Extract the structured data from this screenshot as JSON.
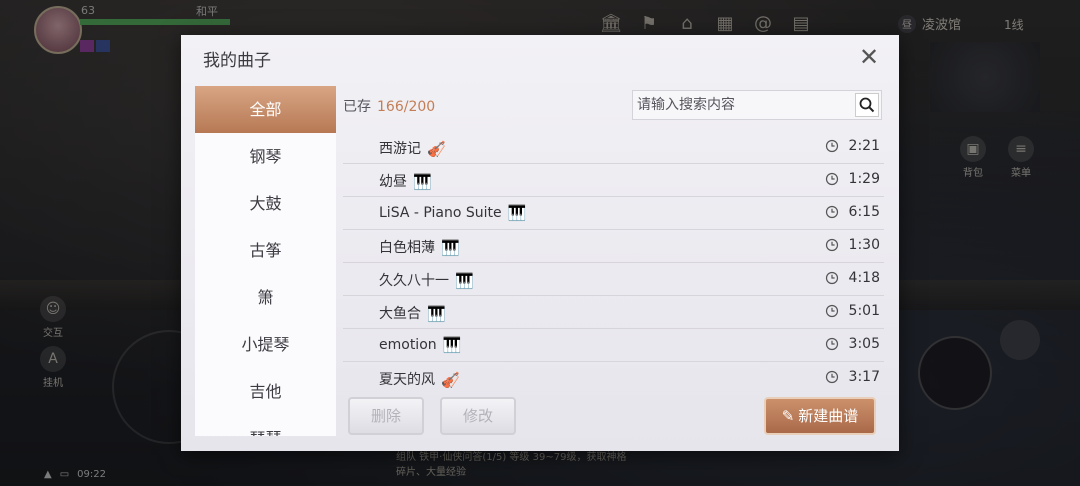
{
  "hud": {
    "level": "63",
    "mode": "和平",
    "location": "凌波馆",
    "location_badge": "昼",
    "line": "1线",
    "side_left": [
      "交互",
      "挂机"
    ],
    "side_right": [
      "背包",
      "菜单"
    ],
    "task_text": "组队  铁甲·仙侠问答(1/5)  等级 39~79级，获取神格碎片、大量经验",
    "time": "09:22"
  },
  "modal": {
    "title": "我的曲子",
    "close_icon": "close-icon",
    "categories": [
      "全部",
      "钢琴",
      "大鼓",
      "古筝",
      "箫",
      "小提琴",
      "吉他",
      "琵琶"
    ],
    "active_category": "全部",
    "stored_label": "已存",
    "stored_count": "166/200",
    "search_placeholder": "请输入搜索内容",
    "songs": [
      {
        "name": "西游记",
        "instrument": "violin-icon",
        "duration": "2:21"
      },
      {
        "name": "幼昼",
        "instrument": "piano-icon",
        "duration": "1:29"
      },
      {
        "name": "LiSA - Piano Suite",
        "instrument": "piano-icon",
        "duration": "6:15"
      },
      {
        "name": "白色相薄",
        "instrument": "piano-icon",
        "duration": "1:30"
      },
      {
        "name": "久久八十一",
        "instrument": "piano-icon",
        "duration": "4:18"
      },
      {
        "name": "大鱼合",
        "instrument": "piano-icon",
        "duration": "5:01"
      },
      {
        "name": "emotion",
        "instrument": "piano-icon",
        "duration": "3:05"
      },
      {
        "name": "夏天的风",
        "instrument": "violin-icon",
        "duration": "3:17"
      }
    ],
    "delete_label": "删除",
    "edit_label": "修改",
    "new_label": "新建曲谱"
  },
  "colors": {
    "accent": "#c47e56",
    "active_tab": "#b77954",
    "modal_bg": "#eeedf2"
  }
}
